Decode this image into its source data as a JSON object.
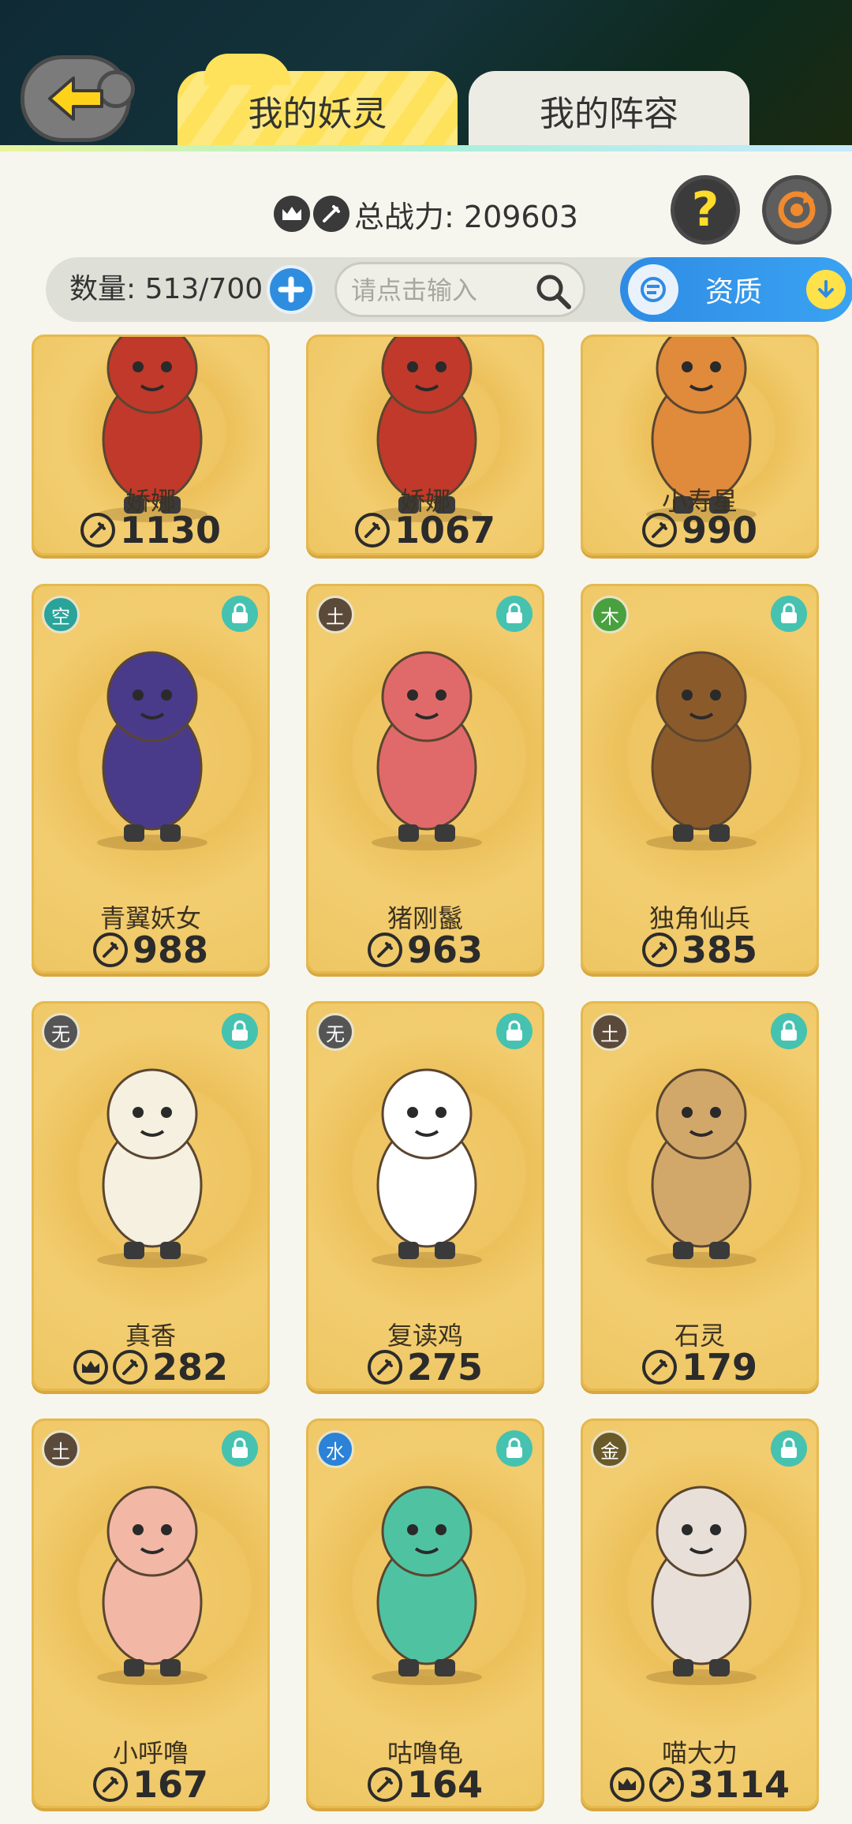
{
  "header": {
    "tabs": [
      {
        "label": "我的妖灵",
        "active": true
      },
      {
        "label": "我的阵容",
        "active": false
      }
    ]
  },
  "power_row": {
    "label": "总战力: 209603"
  },
  "toolbar": {
    "count_label": "数量: 513/700",
    "search_placeholder": "请点击输入",
    "quality_label": "资质"
  },
  "cards": [
    {
      "name": "娇娜",
      "power": "1130",
      "element": "",
      "crown": false,
      "locked": false,
      "color": "#c0392b"
    },
    {
      "name": "娇娜",
      "power": "1067",
      "element": "",
      "crown": false,
      "locked": false,
      "color": "#c0392b"
    },
    {
      "name": "小寿星",
      "power": "990",
      "element": "",
      "crown": false,
      "locked": false,
      "color": "#e08a3c"
    },
    {
      "name": "青翼妖女",
      "power": "988",
      "element": "空",
      "crown": false,
      "locked": true,
      "color": "#4a3a8a"
    },
    {
      "name": "猪刚鬣",
      "power": "963",
      "element": "土",
      "crown": false,
      "locked": true,
      "color": "#e06a6a"
    },
    {
      "name": "独角仙兵",
      "power": "385",
      "element": "木",
      "crown": false,
      "locked": true,
      "color": "#8b5a2b"
    },
    {
      "name": "真香",
      "power": "282",
      "element": "无",
      "crown": true,
      "locked": true,
      "color": "#f5f0e0"
    },
    {
      "name": "复读鸡",
      "power": "275",
      "element": "无",
      "crown": false,
      "locked": true,
      "color": "#ffffff"
    },
    {
      "name": "石灵",
      "power": "179",
      "element": "土",
      "crown": false,
      "locked": true,
      "color": "#d2a86a"
    },
    {
      "name": "小呼噜",
      "power": "167",
      "element": "土",
      "crown": false,
      "locked": true,
      "color": "#f3b7a6"
    },
    {
      "name": "咕噜龟",
      "power": "164",
      "element": "水",
      "crown": false,
      "locked": true,
      "color": "#4fc3a1"
    },
    {
      "name": "喵大力",
      "power": "3114",
      "element": "金",
      "crown": true,
      "locked": true,
      "color": "#e8e0d8"
    }
  ]
}
